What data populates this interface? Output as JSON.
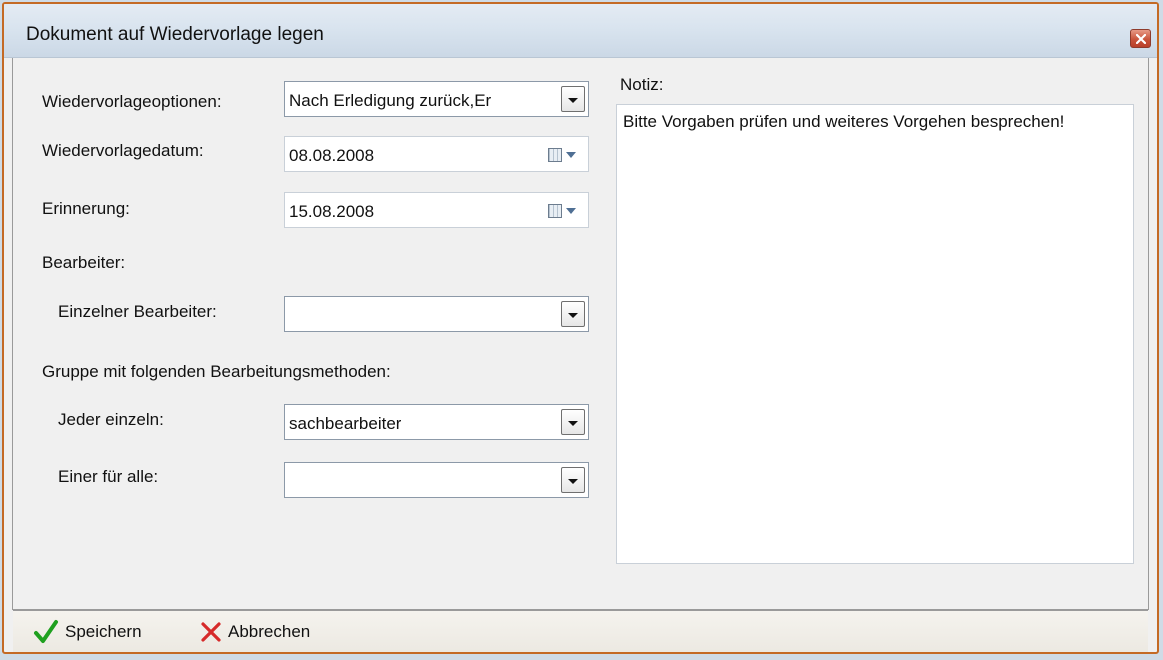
{
  "window": {
    "title": "Dokument auf Wiedervorlage legen"
  },
  "form": {
    "options_label": "Wiedervorlageoptionen:",
    "options_value": "Nach Erledigung zurück,Er",
    "date_label": "Wiedervorlagedatum:",
    "date_value": "08.08.2008",
    "reminder_label": "Erinnerung:",
    "reminder_value": "15.08.2008",
    "editor_section": "Bearbeiter:",
    "single_editor_label": "Einzelner Bearbeiter:",
    "single_editor_value": "",
    "group_section": "Gruppe mit folgenden Bearbeitungsmethoden:",
    "each_label": "Jeder einzeln:",
    "each_value": "sachbearbeiter",
    "one_for_all_label": "Einer für alle:",
    "one_for_all_value": ""
  },
  "notes": {
    "label": "Notiz:",
    "text": "Bitte Vorgaben prüfen und weiteres Vorgehen besprechen!"
  },
  "toolbar": {
    "save_label": "Speichern",
    "cancel_label": "Abbrechen"
  },
  "colors": {
    "frame_border": "#c46a25",
    "save_icon": "#1fa01f",
    "cancel_icon": "#d62a2a"
  }
}
